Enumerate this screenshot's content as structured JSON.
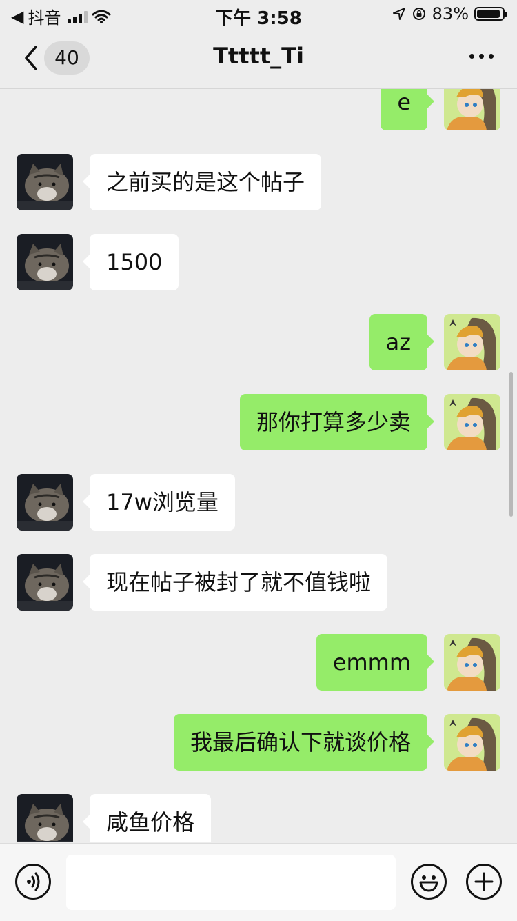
{
  "status_bar": {
    "back_app": "抖音",
    "time": "下午 3:58",
    "battery": "83%",
    "battery_level": 0.83
  },
  "nav": {
    "unread_count": "40",
    "title": "Ttttt_Ti"
  },
  "messages": [
    {
      "side": "right",
      "text": "e"
    },
    {
      "side": "left",
      "text": "之前买的是这个帖子"
    },
    {
      "side": "left",
      "text": "1500"
    },
    {
      "side": "right",
      "text": "az"
    },
    {
      "side": "right",
      "text": "那你打算多少卖"
    },
    {
      "side": "left",
      "text": "17w浏览量"
    },
    {
      "side": "left",
      "text": "现在帖子被封了就不值钱啦"
    },
    {
      "side": "right",
      "text": "emmm"
    },
    {
      "side": "right",
      "text": "我最后确认下就谈价格"
    },
    {
      "side": "left",
      "text": "咸鱼价格"
    }
  ],
  "input": {
    "value": "",
    "placeholder": ""
  },
  "colors": {
    "background": "#ededed",
    "incoming_bubble": "#ffffff",
    "outgoing_bubble": "#95ec69"
  },
  "icons": {
    "back": "chevron-left-icon",
    "more": "more-dots-icon",
    "voice": "voice-icon",
    "emoji": "emoji-icon",
    "plus": "plus-icon"
  }
}
